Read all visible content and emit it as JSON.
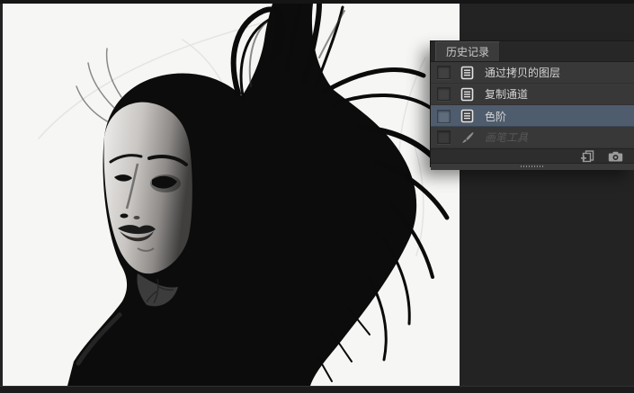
{
  "canvas": {
    "description": "High-contrast black and white portrait of a woman with wild flowing hair sweeping up and to the right"
  },
  "history_panel": {
    "tab_label": "历史记录",
    "items": [
      {
        "id": "layer-via-copy",
        "label": "通过拷贝的图层",
        "icon": "document-icon",
        "selected": false,
        "disabled": false
      },
      {
        "id": "duplicate-channel",
        "label": "复制通道",
        "icon": "document-icon",
        "selected": false,
        "disabled": false
      },
      {
        "id": "levels",
        "label": "色阶",
        "icon": "document-icon",
        "selected": true,
        "disabled": false
      },
      {
        "id": "brush-tool",
        "label": "画笔工具",
        "icon": "brush-icon",
        "selected": false,
        "disabled": true
      }
    ],
    "footer_buttons": [
      {
        "id": "new-document-from-state",
        "icon": "new-document-from-state-icon"
      },
      {
        "id": "new-snapshot",
        "icon": "camera-icon"
      }
    ],
    "colors": {
      "selected_row": "#4e5c6d",
      "panel_bg": "#2d2d2d",
      "canvas_bg": "#f6f6f4"
    }
  }
}
